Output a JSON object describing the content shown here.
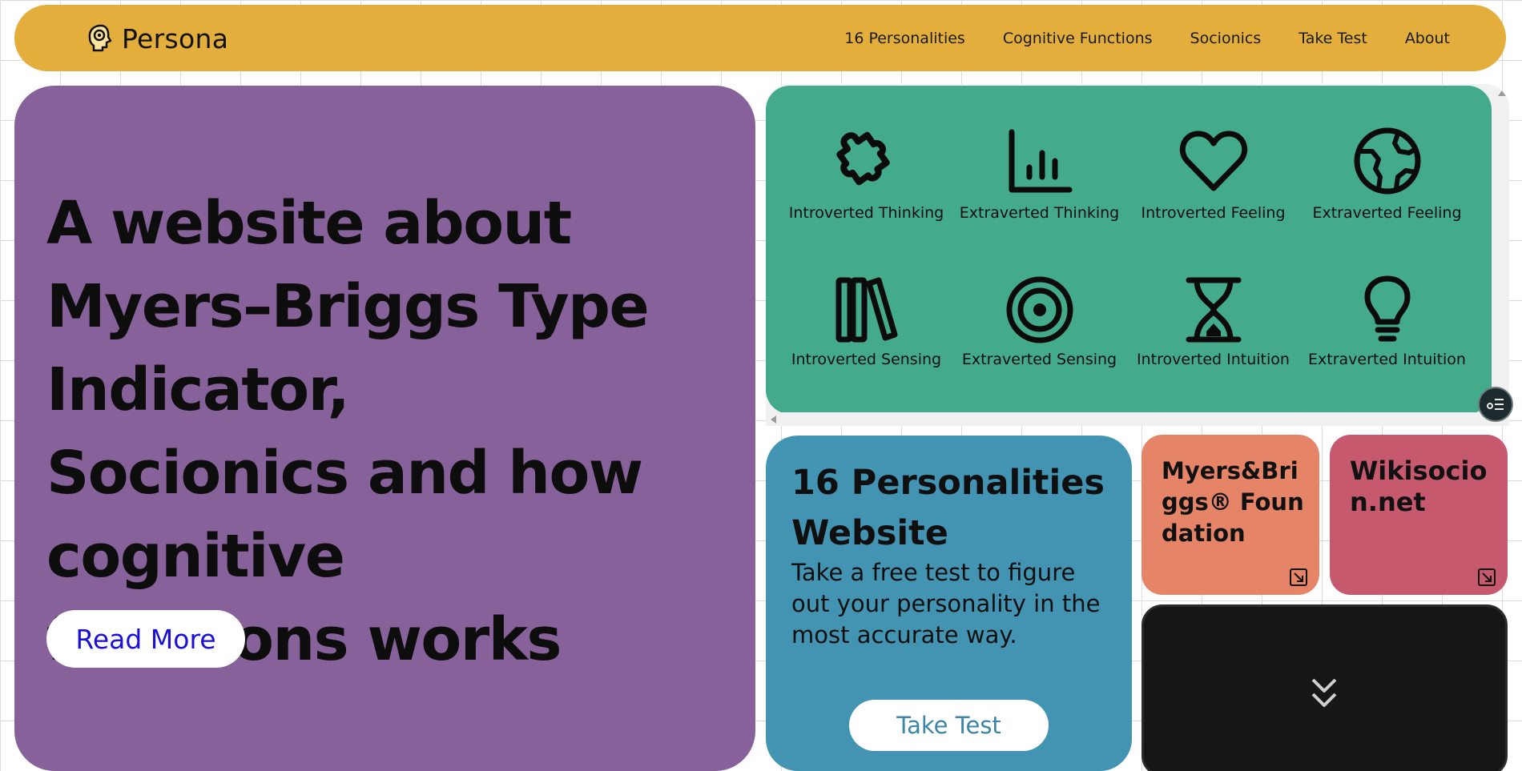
{
  "nav": {
    "brand": "Persona",
    "links": [
      "16 Personalities",
      "Cognitive Functions",
      "Socionics",
      "Take Test",
      "About"
    ]
  },
  "hero": {
    "title": "A website about Myers–Briggs Type Indicator, Socionics and how cognitive functions works",
    "button": "Read More"
  },
  "functions": [
    {
      "label": "Introverted Thinking",
      "icon": "puzzle-icon"
    },
    {
      "label": "Extraverted Thinking",
      "icon": "bar-chart-icon"
    },
    {
      "label": "Introverted Feeling",
      "icon": "heart-icon"
    },
    {
      "label": "Extraverted Feeling",
      "icon": "globe-icon"
    },
    {
      "label": "Introverted Sensing",
      "icon": "books-icon"
    },
    {
      "label": "Extraverted Sensing",
      "icon": "target-icon"
    },
    {
      "label": "Introverted Intuition",
      "icon": "hourglass-icon"
    },
    {
      "label": "Extraverted Intuition",
      "icon": "lightbulb-icon"
    }
  ],
  "card16": {
    "title": "16 Personalities Website",
    "description": "Take a free test to figure out your personality in the most accurate way.",
    "button": "Take Test"
  },
  "link_cards": [
    {
      "title": "Myers&Briggs® Foundation"
    },
    {
      "title": "Wikisocion.net"
    }
  ],
  "colors": {
    "navbar": "#e3ae3b",
    "hero": "#87629a",
    "functions": "#44aa8c",
    "card16": "#4394b3",
    "myers_briggs": "#e68468",
    "wikisocion": "#c7596f",
    "dark_card": "#161616"
  }
}
